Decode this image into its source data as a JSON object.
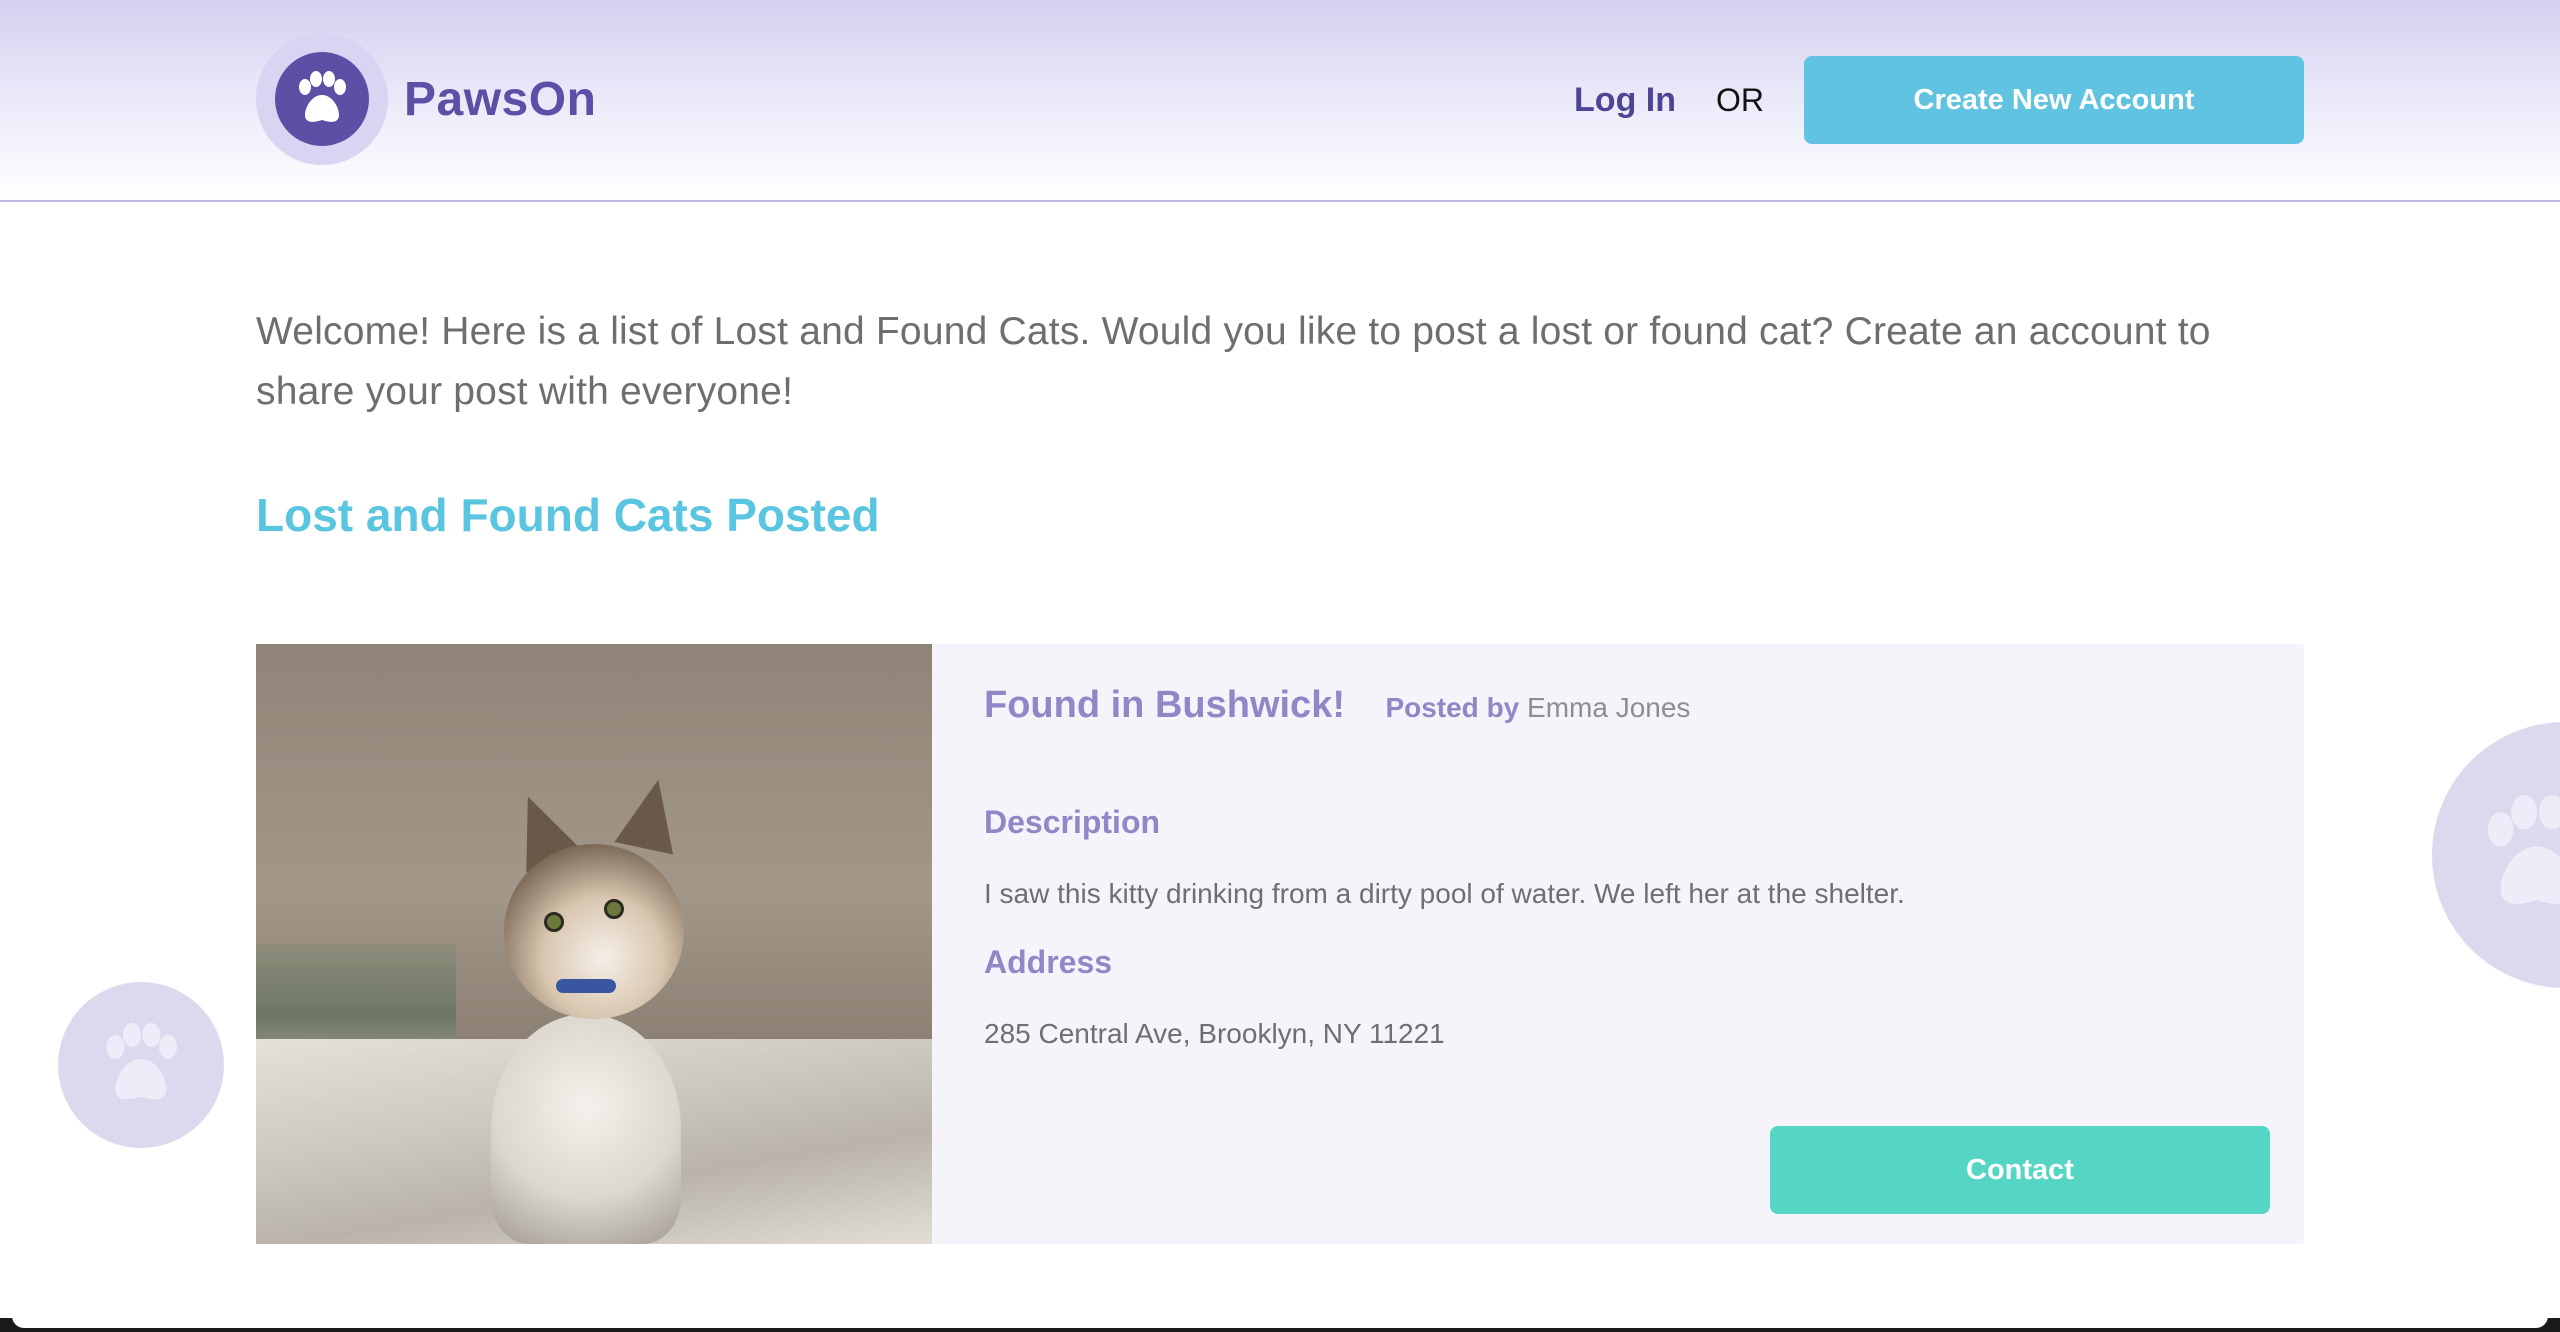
{
  "header": {
    "brand_name": "PawsOn",
    "logo_icon": "paw-icon",
    "login_label": "Log In",
    "or_label": "OR",
    "create_account_label": "Create New Account"
  },
  "intro": {
    "text": "Welcome! Here is a list of Lost and Found Cats. Would you like to post a lost or found cat? Create an account to share your post with everyone!"
  },
  "section": {
    "title": "Lost and Found Cats Posted"
  },
  "posts": [
    {
      "title": "Found in Bushwick!",
      "posted_by_label": "Posted by",
      "author": "Emma Jones",
      "description_label": "Description",
      "description": "I saw this kitty drinking from a dirty pool of water. We left her at the shelter.",
      "address_label": "Address",
      "address": "285 Central Ave, Brooklyn, NY 11221",
      "contact_label": "Contact",
      "photo_subject": "calico kitten at shelter"
    }
  ],
  "colors": {
    "brand_purple": "#5b4fa6",
    "accent_blue": "#60c3e2",
    "contact_teal": "#55d6c5",
    "card_bg": "#f5f4fb",
    "heading_purple": "#9286c7"
  }
}
